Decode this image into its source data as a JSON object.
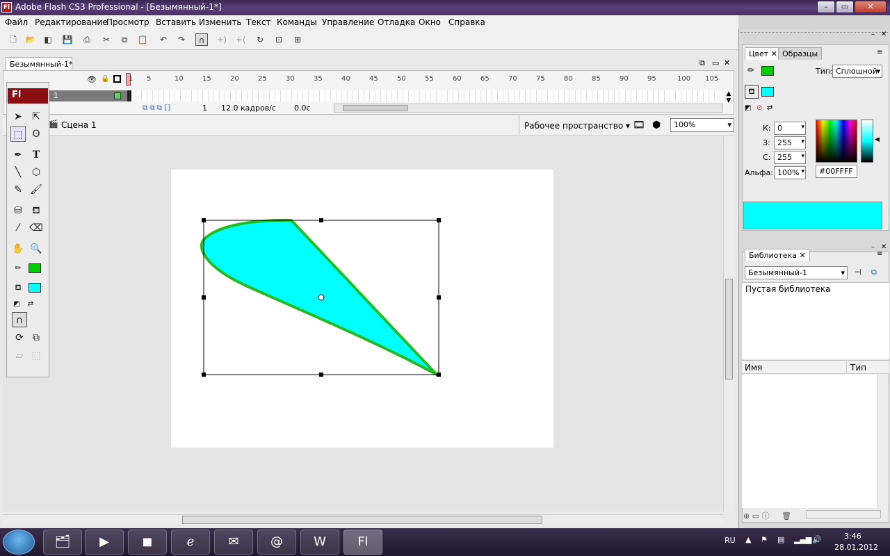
{
  "window": {
    "title": "Adobe Flash CS3 Professional - [Безымянный-1*]",
    "app_icon": "Fl",
    "controls": [
      "–",
      "▭",
      "✕"
    ]
  },
  "menu": [
    "Файл",
    "Редактирование",
    "Просмотр",
    "Вставить",
    "Изменить",
    "Текст",
    "Команды",
    "Управление",
    "Отладка",
    "Окно",
    "Справка"
  ],
  "toolbar_icons": [
    "new-icon",
    "open-icon",
    "bridge-icon",
    "save-icon",
    "print-icon",
    "cut-icon",
    "copy-icon",
    "paste-icon",
    "undo-icon",
    "redo-icon",
    "snap-icon",
    "smooth-icon",
    "straighten-icon",
    "rotate-icon",
    "scale-icon",
    "align-icon"
  ],
  "document": {
    "tab": "Безымянный-1*",
    "timeline": {
      "layer": "1",
      "ruler": [
        "1",
        "5",
        "10",
        "15",
        "20",
        "25",
        "30",
        "35",
        "40",
        "45",
        "50",
        "55",
        "60",
        "65",
        "70",
        "75",
        "80",
        "85",
        "90",
        "95",
        "100",
        "105"
      ],
      "frame": "1",
      "fps": "12.0 кадров/с",
      "time": "0.0с"
    },
    "scene": "Сцена 1",
    "workspace": "Рабочее пространство",
    "zoom": "100%"
  },
  "tools": {
    "header": "Fl"
  },
  "color_panel": {
    "tabs": [
      "Цвет",
      "Образцы"
    ],
    "type_label": "Тип:",
    "type_value": "Сплошной",
    "r_label": "К:",
    "r": "0",
    "g_label": "З:",
    "g": "255",
    "b_label": "С:",
    "b": "255",
    "alpha_label": "Альфа:",
    "alpha": "100%",
    "hex": "#00FFFF",
    "stroke_color": "#00cc00",
    "fill_color": "#00ffff"
  },
  "library_panel": {
    "tab": "Библиотека",
    "doc": "Безымянный-1",
    "status": "Пустая библиотека",
    "col_name": "Имя",
    "col_type": "Тип"
  },
  "taskbar": {
    "lang": "RU",
    "time": "3:46",
    "date": "28.01.2012"
  }
}
